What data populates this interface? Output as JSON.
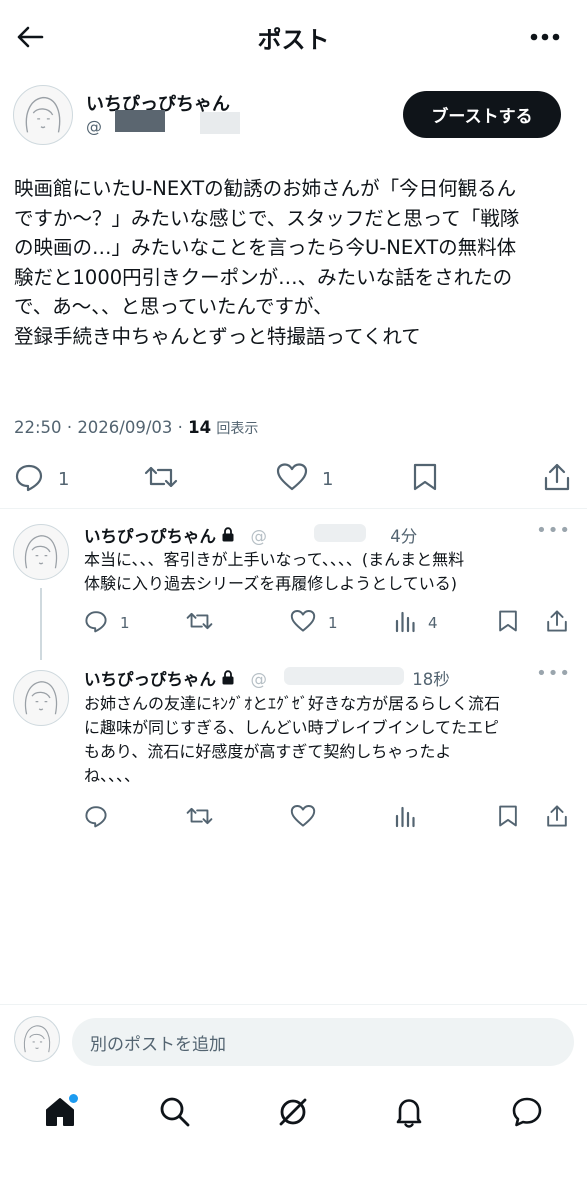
{
  "header": {
    "title": "ポスト"
  },
  "post": {
    "author_name": "いちぴっぴちゃん",
    "author_handle": "@",
    "boost_label": "ブーストする",
    "body_lines": [
      "映画館にいたU-NEXTの勧誘のお姉さんが「今日何観るん",
      "ですか〜？」みたいな感じで、スタッフだと思って「戦隊",
      "の映画の…」みたいなことを言ったら今U-NEXTの無料体",
      "験だと1000円引きクーポンが…、みたいな話をされたの",
      "で、あ〜、、と思っていたんですが、",
      "登録手続き中ちゃんとずっと特撮語ってくれて"
    ],
    "time": "22:50",
    "date": "2026/09/03",
    "views_count": "14",
    "views_label": "回表示",
    "reply_count": "1",
    "like_count": "1"
  },
  "replies": [
    {
      "name": "いちぴっぴちゃん",
      "handle": "@",
      "time": "4分",
      "body_lines": [
        "本当に、、、客引きが上手いなって、、、、(まんまと無料",
        "体験に入り過去シリーズを再履修しようとしている)"
      ],
      "reply_count": "1",
      "like_count": "1",
      "view_count": "4"
    },
    {
      "name": "いちぴっぴちゃん",
      "handle": "@",
      "time": "18秒",
      "body_lines": [
        "お姉さんの友達にｷﾝｸﾞｵとｴｸﾞｾﾞ好きな方が居るらしく流石",
        "に趣味が同じすぎる、しんどい時ブレイブインしてたエピ",
        "もあり、流石に好感度が高すぎて契約しちゃったよ",
        "ね、、、、"
      ]
    }
  ],
  "composer": {
    "placeholder": "別のポストを追加"
  },
  "colors": {
    "accent": "#1d9bf0",
    "text": "#0f1419",
    "muted": "#536471"
  },
  "icons": [
    "back-arrow-icon",
    "more-icon",
    "reply-icon",
    "repost-icon",
    "like-icon",
    "bookmark-icon",
    "share-icon",
    "views-icon",
    "lock-icon",
    "home-icon",
    "search-icon",
    "grok-icon",
    "notifications-icon",
    "messages-icon"
  ]
}
